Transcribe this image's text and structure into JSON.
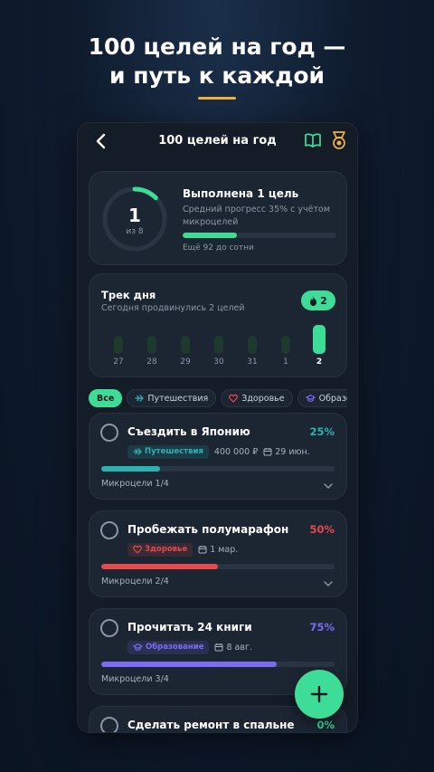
{
  "promo": {
    "headline_line1": "100 целей на год —",
    "headline_line2": "и путь к каждой",
    "accent_color": "#f0b43c"
  },
  "appbar": {
    "title": "100 целей на год",
    "back_icon": "chevron-left-icon",
    "book_icon": "book-icon",
    "medal_icon": "medal-icon"
  },
  "summary": {
    "done_count": "1",
    "of_total": "из 8",
    "title": "Выполнена 1 цель",
    "subtitle": "Средний прогресс 35% с учётом микроцелей",
    "progress_fraction": 0.35,
    "remaining": "Ещё 92 до сотни"
  },
  "streak": {
    "title": "Трек дня",
    "subtitle": "Сегодня продвинулись 2 целей",
    "badge_count": "2",
    "badge_icon": "fire-icon",
    "days": [
      {
        "label": "27",
        "active": false
      },
      {
        "label": "28",
        "active": false
      },
      {
        "label": "29",
        "active": false
      },
      {
        "label": "30",
        "active": false
      },
      {
        "label": "31",
        "active": false
      },
      {
        "label": "1",
        "active": false
      },
      {
        "label": "2",
        "active": true
      }
    ]
  },
  "filters": [
    {
      "label": "Все",
      "icon": "",
      "active": true
    },
    {
      "label": "Путешествия",
      "icon": "plane-icon",
      "active": false
    },
    {
      "label": "Здоровье",
      "icon": "heart-icon",
      "active": false
    },
    {
      "label": "Образование",
      "icon": "graduation-cap-icon",
      "active": false
    }
  ],
  "goals": [
    {
      "title": "Съездить в Японию",
      "percent": "25%",
      "progress": 0.25,
      "tag": "Путешествия",
      "tag_icon": "plane-icon",
      "tag_color": "#2bb3b3",
      "budget": "400 000 ₽",
      "date": "29 июн.",
      "micro": "Микроцели 1/4",
      "color": "#2bb3b3"
    },
    {
      "title": "Пробежать полумарафон",
      "percent": "50%",
      "progress": 0.5,
      "tag": "Здоровье",
      "tag_icon": "heart-icon",
      "tag_color": "#e5484d",
      "budget": "",
      "date": "1 мар.",
      "micro": "Микроцели 2/4",
      "color": "#e5484d"
    },
    {
      "title": "Прочитать 24 книги",
      "percent": "75%",
      "progress": 0.75,
      "tag": "Образование",
      "tag_icon": "graduation-cap-icon",
      "tag_color": "#7b6cf6",
      "budget": "",
      "date": "8 авг.",
      "micro": "Микроцели 3/4",
      "color": "#7b6cf6"
    },
    {
      "title": "Сделать ремонт в спальне",
      "percent": "0%",
      "progress": 0,
      "color": "#3ddc97"
    }
  ],
  "fab": {
    "icon": "plus-icon"
  }
}
